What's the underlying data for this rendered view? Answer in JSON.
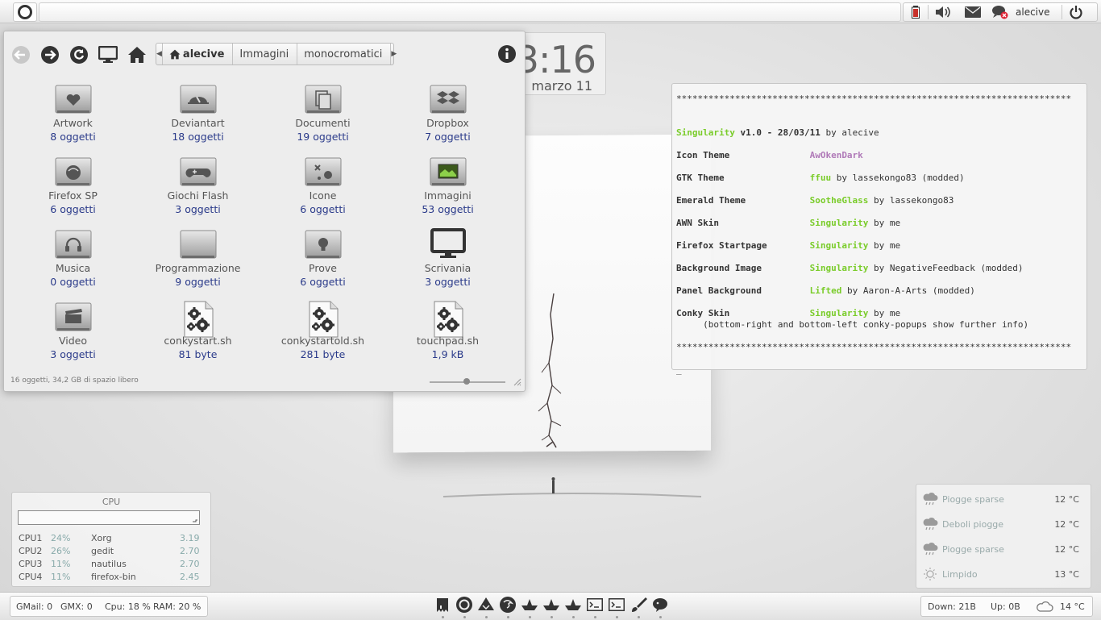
{
  "top_panel": {
    "user_name": "alecive",
    "tray_icons": [
      "battery-icon",
      "volume-icon",
      "mail-icon",
      "chat-status-icon",
      "power-icon"
    ]
  },
  "clock": {
    "time": "13:16",
    "date": "marzo 11"
  },
  "file_manager": {
    "breadcrumbs": [
      "alecive",
      "Immagini",
      "monocromatici"
    ],
    "items": [
      {
        "name": "Artwork",
        "info": "8 oggetti",
        "icon": "heart-folder-icon"
      },
      {
        "name": "Deviantart",
        "info": "18 oggetti",
        "icon": "deviantart-folder-icon"
      },
      {
        "name": "Documenti",
        "info": "19 oggetti",
        "icon": "documents-folder-icon"
      },
      {
        "name": "Dropbox",
        "info": "7 oggetti",
        "icon": "dropbox-folder-icon"
      },
      {
        "name": "Firefox SP",
        "info": "6 oggetti",
        "icon": "firefox-folder-icon"
      },
      {
        "name": "Giochi Flash",
        "info": "3 oggetti",
        "icon": "gamepad-folder-icon"
      },
      {
        "name": "Icone",
        "info": "6 oggetti",
        "icon": "icons-folder-icon"
      },
      {
        "name": "Immagini",
        "info": "53 oggetti",
        "icon": "pictures-folder-icon"
      },
      {
        "name": "Musica",
        "info": "0 oggetti",
        "icon": "music-folder-icon"
      },
      {
        "name": "Programmazione",
        "info": "9 oggetti",
        "icon": "plain-folder-icon"
      },
      {
        "name": "Prove",
        "info": "6 oggetti",
        "icon": "bulb-folder-icon"
      },
      {
        "name": "Scrivania",
        "info": "3 oggetti",
        "icon": "desktop-monitor-icon"
      },
      {
        "name": "Video",
        "info": "3 oggetti",
        "icon": "video-folder-icon"
      },
      {
        "name": "conkystart.sh",
        "info": "81 byte",
        "icon": "script-file-icon"
      },
      {
        "name": "conkystartold.sh",
        "info": "281 byte",
        "icon": "script-file-icon"
      },
      {
        "name": "touchpad.sh",
        "info": "1,9 kB",
        "icon": "script-file-icon"
      }
    ],
    "status": "16 oggetti, 34,2 GB di spazio libero"
  },
  "conky": {
    "stars": "**************************************************************************",
    "title_name": "Singularity",
    "title_version": " v1.0 - 28/03/11",
    "title_by": " by alecive",
    "rows": [
      {
        "label": "Icon Theme",
        "value": "AwOkenDark",
        "rest": "",
        "color": "purple"
      },
      {
        "label": "GTK Theme",
        "value": "ffuu",
        "rest": " by lassekongo83 (modded)",
        "color": "green"
      },
      {
        "label": "Emerald Theme",
        "value": "SootheGlass",
        "rest": " by lassekongo83",
        "color": "green"
      },
      {
        "label": "AWN Skin",
        "value": "Singularity",
        "rest": " by me",
        "color": "green"
      },
      {
        "label": "Firefox Startpage",
        "value": "Singularity",
        "rest": " by me",
        "color": "green"
      },
      {
        "label": "Background Image",
        "value": "Singularity",
        "rest": " by NegativeFeedback (modded)",
        "color": "green"
      },
      {
        "label": "Panel Background",
        "value": "Lifted",
        "rest": " by Aaron-A-Arts (modded)",
        "color": "green"
      },
      {
        "label": "Conky Skin",
        "value": "Singularity",
        "rest": " by me",
        "color": "green"
      }
    ],
    "note": "(bottom-right and bottom-left conky-popups show further info)",
    "cursor": "_"
  },
  "cpu_widget": {
    "title": "CPU",
    "rows": [
      {
        "cpu": "CPU1",
        "pct": "24%",
        "proc": "Xorg",
        "val": "3.19"
      },
      {
        "cpu": "CPU2",
        "pct": "26%",
        "proc": "gedit",
        "val": "2.70"
      },
      {
        "cpu": "CPU3",
        "pct": "11%",
        "proc": "nautilus",
        "val": "2.70"
      },
      {
        "cpu": "CPU4",
        "pct": "11%",
        "proc": "firefox-bin",
        "val": "2.45"
      }
    ]
  },
  "weather": [
    {
      "desc": "Piogge sparse",
      "temp": "12 °C",
      "icon": "rain-cloud-icon"
    },
    {
      "desc": "Deboli piogge",
      "temp": "12 °C",
      "icon": "rain-cloud-icon"
    },
    {
      "desc": "Piogge sparse",
      "temp": "12 °C",
      "icon": "rain-cloud-icon"
    },
    {
      "desc": "Limpido",
      "temp": "13 °C",
      "icon": "sun-icon"
    }
  ],
  "bottom_panel": {
    "gmail": "GMail: 0",
    "gmx": "GMX: 0",
    "cpu": "Cpu: 18 %",
    "ram": "RAM: 20 %",
    "down": "Down: 21B",
    "up": "Up: 0B",
    "temp": "14 °C",
    "dock_icons": [
      "nautilus-icon",
      "ubuntu-icon",
      "inkscape-icon",
      "firefox-icon",
      "boat-icon",
      "boat-icon",
      "boat-icon",
      "terminal-icon",
      "terminal-icon",
      "brush-icon",
      "pidgin-icon"
    ]
  },
  "colors": {
    "accent_green": "#7acc2a",
    "accent_purple": "#b07ab8",
    "count_blue": "#2a3a8a"
  }
}
